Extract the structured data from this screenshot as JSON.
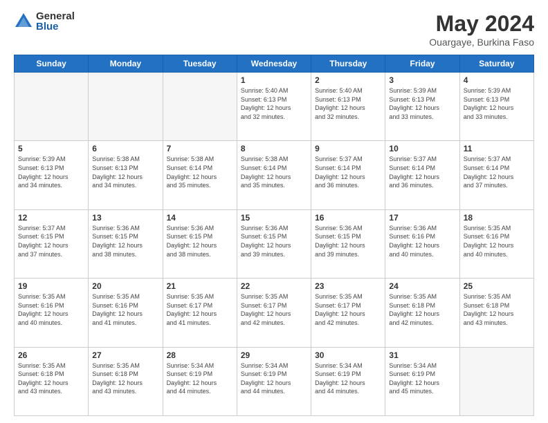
{
  "logo": {
    "general": "General",
    "blue": "Blue"
  },
  "title": "May 2024",
  "subtitle": "Ouargaye, Burkina Faso",
  "headers": [
    "Sunday",
    "Monday",
    "Tuesday",
    "Wednesday",
    "Thursday",
    "Friday",
    "Saturday"
  ],
  "weeks": [
    [
      {
        "day": "",
        "info": ""
      },
      {
        "day": "",
        "info": ""
      },
      {
        "day": "",
        "info": ""
      },
      {
        "day": "1",
        "info": "Sunrise: 5:40 AM\nSunset: 6:13 PM\nDaylight: 12 hours\nand 32 minutes."
      },
      {
        "day": "2",
        "info": "Sunrise: 5:40 AM\nSunset: 6:13 PM\nDaylight: 12 hours\nand 32 minutes."
      },
      {
        "day": "3",
        "info": "Sunrise: 5:39 AM\nSunset: 6:13 PM\nDaylight: 12 hours\nand 33 minutes."
      },
      {
        "day": "4",
        "info": "Sunrise: 5:39 AM\nSunset: 6:13 PM\nDaylight: 12 hours\nand 33 minutes."
      }
    ],
    [
      {
        "day": "5",
        "info": "Sunrise: 5:39 AM\nSunset: 6:13 PM\nDaylight: 12 hours\nand 34 minutes."
      },
      {
        "day": "6",
        "info": "Sunrise: 5:38 AM\nSunset: 6:13 PM\nDaylight: 12 hours\nand 34 minutes."
      },
      {
        "day": "7",
        "info": "Sunrise: 5:38 AM\nSunset: 6:14 PM\nDaylight: 12 hours\nand 35 minutes."
      },
      {
        "day": "8",
        "info": "Sunrise: 5:38 AM\nSunset: 6:14 PM\nDaylight: 12 hours\nand 35 minutes."
      },
      {
        "day": "9",
        "info": "Sunrise: 5:37 AM\nSunset: 6:14 PM\nDaylight: 12 hours\nand 36 minutes."
      },
      {
        "day": "10",
        "info": "Sunrise: 5:37 AM\nSunset: 6:14 PM\nDaylight: 12 hours\nand 36 minutes."
      },
      {
        "day": "11",
        "info": "Sunrise: 5:37 AM\nSunset: 6:14 PM\nDaylight: 12 hours\nand 37 minutes."
      }
    ],
    [
      {
        "day": "12",
        "info": "Sunrise: 5:37 AM\nSunset: 6:15 PM\nDaylight: 12 hours\nand 37 minutes."
      },
      {
        "day": "13",
        "info": "Sunrise: 5:36 AM\nSunset: 6:15 PM\nDaylight: 12 hours\nand 38 minutes."
      },
      {
        "day": "14",
        "info": "Sunrise: 5:36 AM\nSunset: 6:15 PM\nDaylight: 12 hours\nand 38 minutes."
      },
      {
        "day": "15",
        "info": "Sunrise: 5:36 AM\nSunset: 6:15 PM\nDaylight: 12 hours\nand 39 minutes."
      },
      {
        "day": "16",
        "info": "Sunrise: 5:36 AM\nSunset: 6:15 PM\nDaylight: 12 hours\nand 39 minutes."
      },
      {
        "day": "17",
        "info": "Sunrise: 5:36 AM\nSunset: 6:16 PM\nDaylight: 12 hours\nand 40 minutes."
      },
      {
        "day": "18",
        "info": "Sunrise: 5:35 AM\nSunset: 6:16 PM\nDaylight: 12 hours\nand 40 minutes."
      }
    ],
    [
      {
        "day": "19",
        "info": "Sunrise: 5:35 AM\nSunset: 6:16 PM\nDaylight: 12 hours\nand 40 minutes."
      },
      {
        "day": "20",
        "info": "Sunrise: 5:35 AM\nSunset: 6:16 PM\nDaylight: 12 hours\nand 41 minutes."
      },
      {
        "day": "21",
        "info": "Sunrise: 5:35 AM\nSunset: 6:17 PM\nDaylight: 12 hours\nand 41 minutes."
      },
      {
        "day": "22",
        "info": "Sunrise: 5:35 AM\nSunset: 6:17 PM\nDaylight: 12 hours\nand 42 minutes."
      },
      {
        "day": "23",
        "info": "Sunrise: 5:35 AM\nSunset: 6:17 PM\nDaylight: 12 hours\nand 42 minutes."
      },
      {
        "day": "24",
        "info": "Sunrise: 5:35 AM\nSunset: 6:18 PM\nDaylight: 12 hours\nand 42 minutes."
      },
      {
        "day": "25",
        "info": "Sunrise: 5:35 AM\nSunset: 6:18 PM\nDaylight: 12 hours\nand 43 minutes."
      }
    ],
    [
      {
        "day": "26",
        "info": "Sunrise: 5:35 AM\nSunset: 6:18 PM\nDaylight: 12 hours\nand 43 minutes."
      },
      {
        "day": "27",
        "info": "Sunrise: 5:35 AM\nSunset: 6:18 PM\nDaylight: 12 hours\nand 43 minutes."
      },
      {
        "day": "28",
        "info": "Sunrise: 5:34 AM\nSunset: 6:19 PM\nDaylight: 12 hours\nand 44 minutes."
      },
      {
        "day": "29",
        "info": "Sunrise: 5:34 AM\nSunset: 6:19 PM\nDaylight: 12 hours\nand 44 minutes."
      },
      {
        "day": "30",
        "info": "Sunrise: 5:34 AM\nSunset: 6:19 PM\nDaylight: 12 hours\nand 44 minutes."
      },
      {
        "day": "31",
        "info": "Sunrise: 5:34 AM\nSunset: 6:19 PM\nDaylight: 12 hours\nand 45 minutes."
      },
      {
        "day": "",
        "info": ""
      }
    ]
  ]
}
